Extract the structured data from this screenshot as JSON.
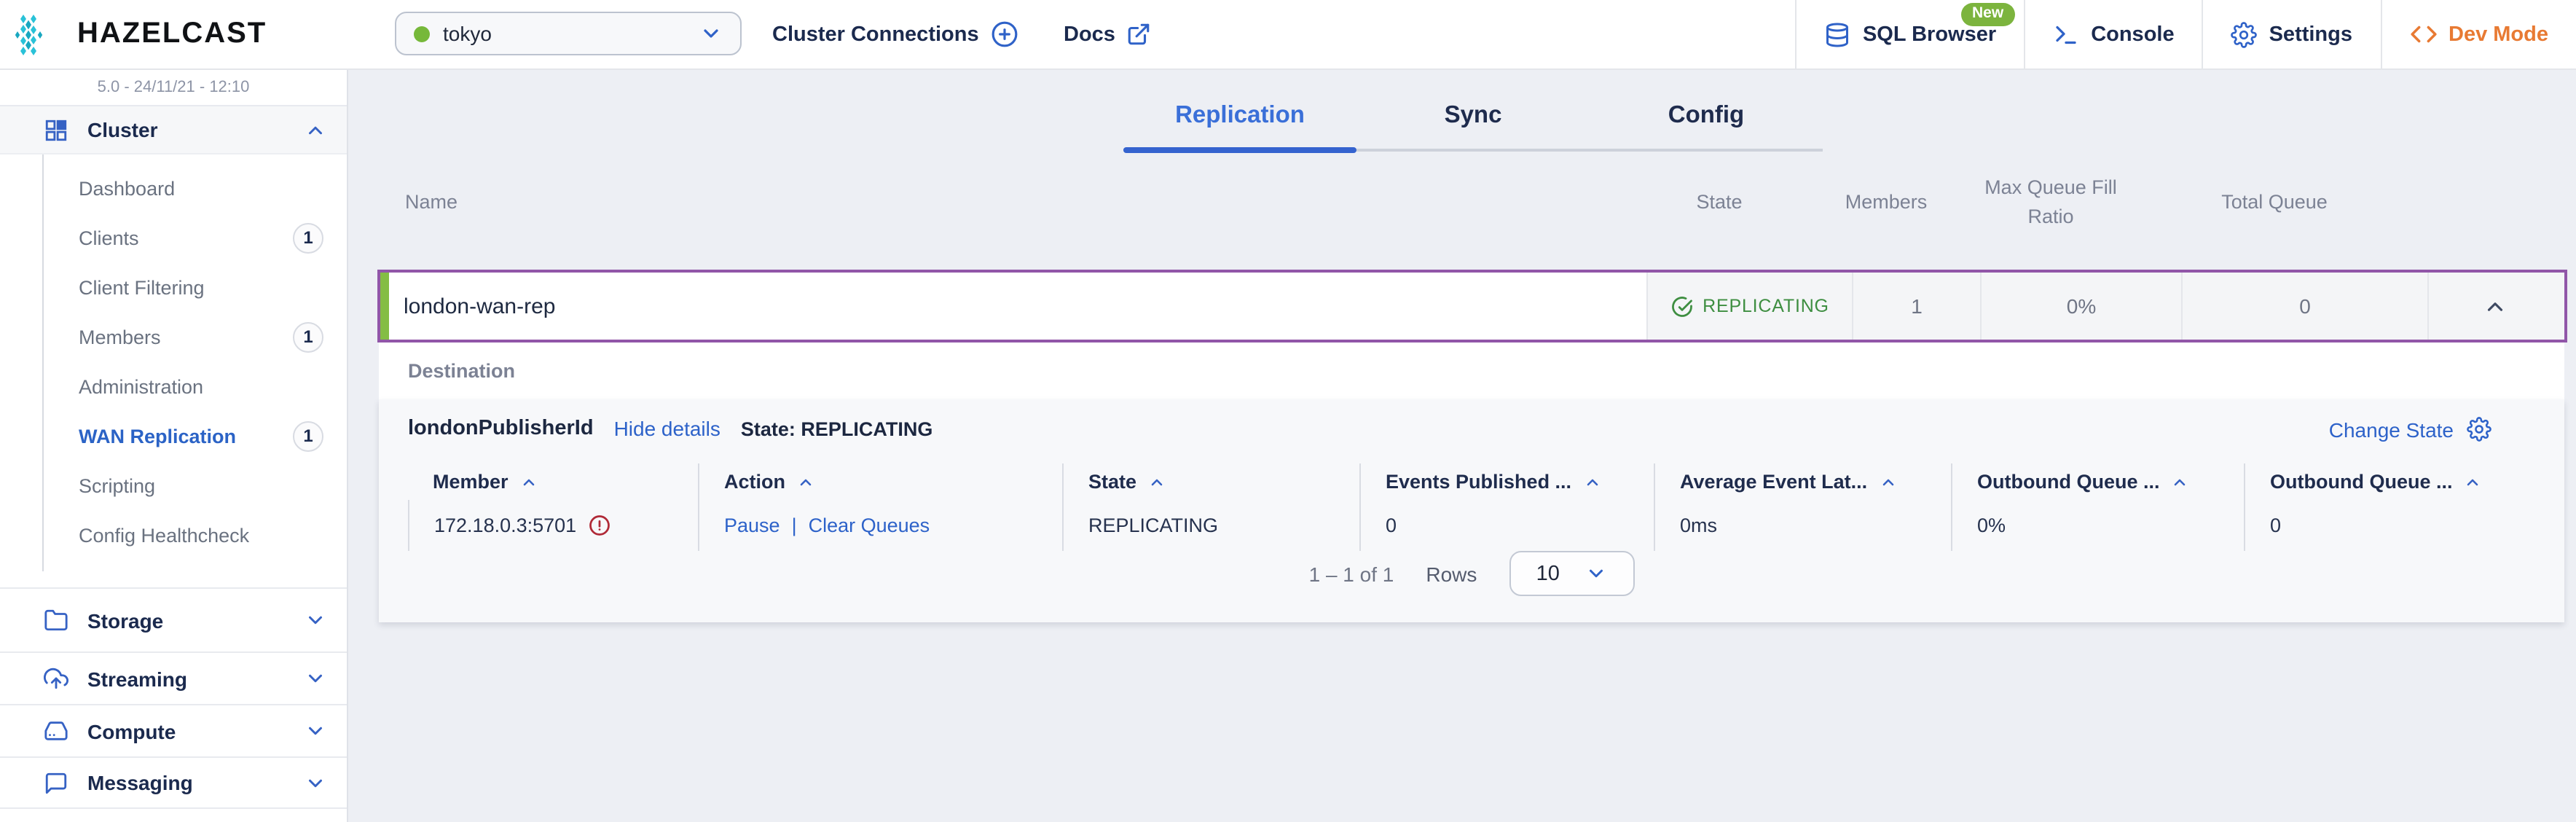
{
  "colors": {
    "brand_teal": "#29c2d8",
    "active_blue": "#3a6fd8",
    "link_blue": "#2d62c9",
    "navy": "#1b2a4e",
    "purple_row_border": "#9156a8",
    "green_accent_bar": "#84bd44",
    "state_green": "#3e8e41",
    "warning_red": "#b02a37",
    "dev_mode_orange": "#e87a33",
    "new_badge_green": "#7cb43e",
    "cluster_status_green": "#76b83a"
  },
  "header": {
    "brand": "HAZELCAST",
    "cluster_select_value": "tokyo",
    "cluster_connections_label": "Cluster Connections",
    "docs_label": "Docs",
    "sql_browser_label": "SQL Browser",
    "new_badge": "New",
    "console_label": "Console",
    "settings_label": "Settings",
    "dev_mode_label": "Dev Mode"
  },
  "sidebar": {
    "version": "5.0 - 24/11/21 - 12:10",
    "cluster_section_label": "Cluster",
    "items": [
      {
        "label": "Dashboard"
      },
      {
        "label": "Clients",
        "badge": "1"
      },
      {
        "label": "Client Filtering"
      },
      {
        "label": "Members",
        "badge": "1"
      },
      {
        "label": "Administration"
      },
      {
        "label": "WAN Replication",
        "badge": "1"
      },
      {
        "label": "Scripting"
      },
      {
        "label": "Config Healthcheck"
      }
    ],
    "sections": [
      {
        "label": "Storage"
      },
      {
        "label": "Streaming"
      },
      {
        "label": "Compute"
      },
      {
        "label": "Messaging"
      }
    ]
  },
  "tabs": {
    "replication": "Replication",
    "sync": "Sync",
    "config": "Config"
  },
  "wan_table": {
    "columns": [
      "Name",
      "State",
      "Members",
      "Max Queue Fill Ratio",
      "Total Queue"
    ],
    "row": {
      "name": "london-wan-rep",
      "state": "REPLICATING",
      "members": "1",
      "max_queue_fill_ratio": "0%",
      "total_queue": "0"
    }
  },
  "destination": {
    "label": "Destination",
    "publisher_id": "londonPublisherId",
    "hide_details_label": "Hide details",
    "state_text": "State: REPLICATING",
    "change_state_label": "Change State",
    "members_table": {
      "columns": [
        "Member",
        "Action",
        "State",
        "Events Published ...",
        "Average Event Lat...",
        "Outbound Queue ...",
        "Outbound Queue ..."
      ],
      "row": {
        "member": "172.18.0.3:5701",
        "action_pause": "Pause",
        "action_separator": "|",
        "action_clear": "Clear Queues",
        "state": "REPLICATING",
        "events_published": "0",
        "average_event_latency": "0ms",
        "outbound_queue_fill": "0%",
        "outbound_queue_size": "0"
      }
    },
    "pagination": {
      "range": "1 – 1 of 1",
      "rows_label": "Rows",
      "rows_value": "10"
    }
  }
}
